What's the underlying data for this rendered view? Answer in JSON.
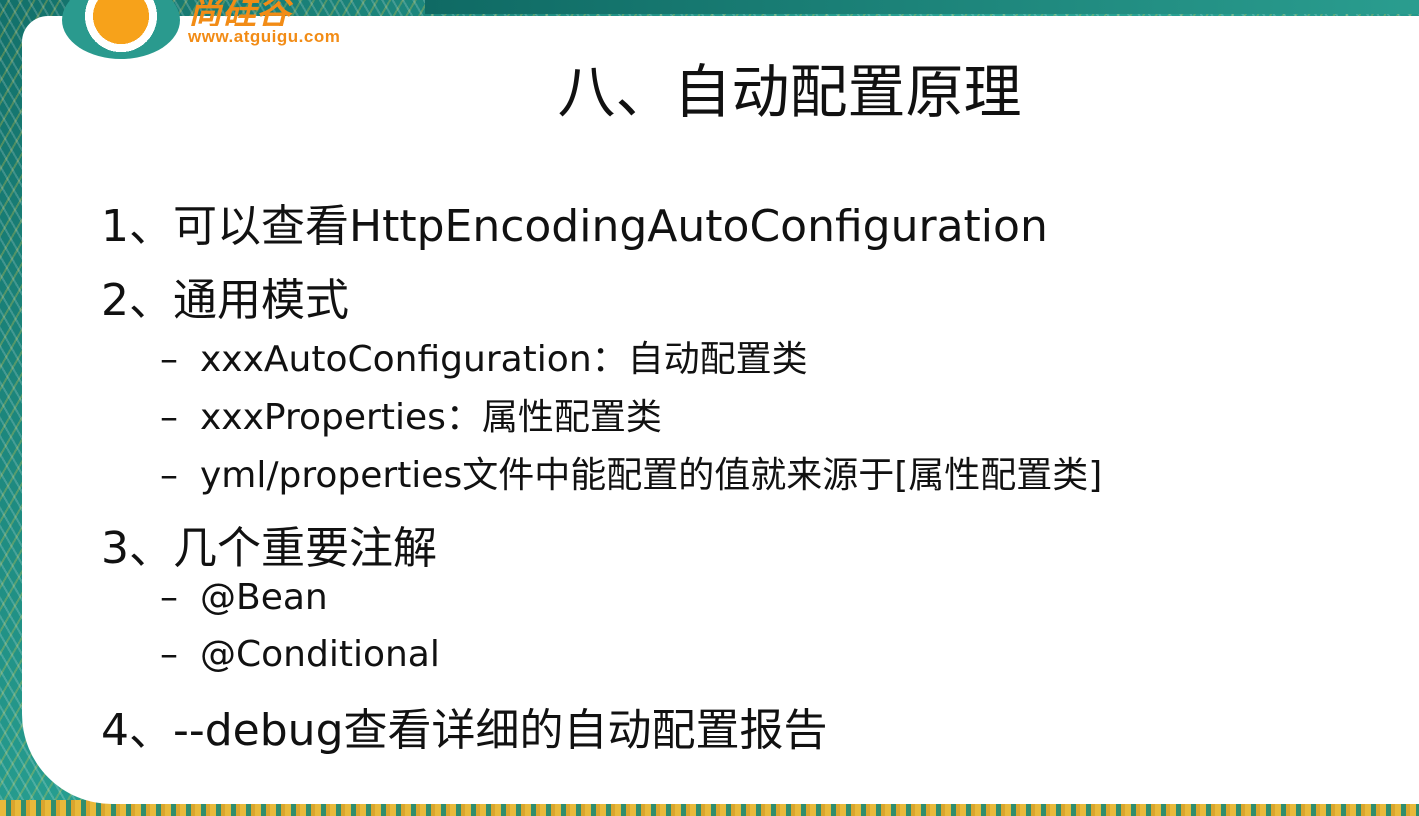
{
  "logo": {
    "brand": "尚硅谷",
    "url": "www.atguigu.com"
  },
  "slide": {
    "title": "八、自动配置原理",
    "items": [
      {
        "text": "1、可以查看HttpEncodingAutoConfiguration"
      },
      {
        "text": "2、通用模式"
      },
      {
        "dash": "–",
        "text": "xxxAutoConfiguration：自动配置类"
      },
      {
        "dash": "–",
        "text": "xxxProperties：属性配置类"
      },
      {
        "dash": "–",
        "text": "yml/properties文件中能配置的值就来源于[属性配置类]"
      },
      {
        "text": "3、几个重要注解"
      },
      {
        "dash": "–",
        "text": "@Bean"
      },
      {
        "dash": "–",
        "text": "@Conditional"
      },
      {
        "text": "4、--debug查看详细的自动配置报告"
      }
    ]
  },
  "colors": {
    "frame": "#1f8f86",
    "logo_orange": "#f28c16",
    "text": "#111111"
  }
}
